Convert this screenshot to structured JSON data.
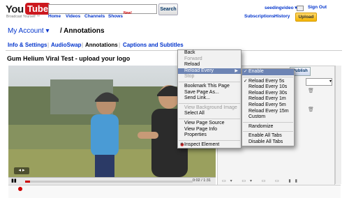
{
  "topbar": {
    "logo_you": "You",
    "logo_tube": "Tube",
    "tagline": "Broadcast Yourself ™",
    "search_button": "Search",
    "nav": [
      "Home",
      "Videos",
      "Channels",
      "Shows"
    ],
    "new_badge": "New!",
    "username": "seedingvideo ▾",
    "sign_out": "Sign Out",
    "subscriptions": "Subscriptions",
    "history": "History",
    "upload": "Upload"
  },
  "account": {
    "my_account": "My Account ▾",
    "title": "/ Annotations",
    "tabs": [
      "Info & Settings",
      "AudioSwap",
      "Annotations",
      "Captions and Subtitles"
    ]
  },
  "video": {
    "title": "Gum Helium Viral Test - upload your logo",
    "time": "0:02 / 1:31",
    "publish": "Publish"
  },
  "context_menu": {
    "items": [
      {
        "label": "Back",
        "disabled": false
      },
      {
        "label": "Forward",
        "disabled": true
      },
      {
        "label": "Reload",
        "disabled": false
      },
      {
        "label": "Reload Every",
        "disabled": false,
        "submenu": true,
        "selected": true
      },
      {
        "label": "Stop",
        "disabled": true
      },
      {
        "sep": true
      },
      {
        "label": "Bookmark This Page",
        "disabled": false
      },
      {
        "label": "Save Page As...",
        "disabled": false
      },
      {
        "label": "Send Link...",
        "disabled": false
      },
      {
        "sep": true
      },
      {
        "label": "View Background Image",
        "disabled": true
      },
      {
        "label": "Select All",
        "disabled": false
      },
      {
        "sep": true
      },
      {
        "label": "View Page Source",
        "disabled": false
      },
      {
        "label": "View Page Info",
        "disabled": false
      },
      {
        "label": "Properties",
        "disabled": false
      },
      {
        "sep": true
      },
      {
        "label": "Inspect Element",
        "disabled": false,
        "icon": "firebug-icon"
      }
    ]
  },
  "submenu": {
    "items": [
      {
        "label": "Enable",
        "checked": true,
        "selected": true
      },
      {
        "sep": true
      },
      {
        "label": "Reload Every 5s",
        "checked": true
      },
      {
        "label": "Reload Every 10s"
      },
      {
        "label": "Reload Every 30s"
      },
      {
        "label": "Reload Every 1m"
      },
      {
        "label": "Reload Every 5m"
      },
      {
        "label": "Reload Every 15m"
      },
      {
        "label": "Custom"
      },
      {
        "sep": true
      },
      {
        "label": "Randomize"
      },
      {
        "sep": true
      },
      {
        "label": "Enable All Tabs"
      },
      {
        "label": "Disable All Tabs"
      }
    ]
  },
  "colors": {
    "brand_red": "#cc181e",
    "link_blue": "#0033cc",
    "menu_highlight": "#6d84b4",
    "upload_yellow": "#f4b400"
  }
}
